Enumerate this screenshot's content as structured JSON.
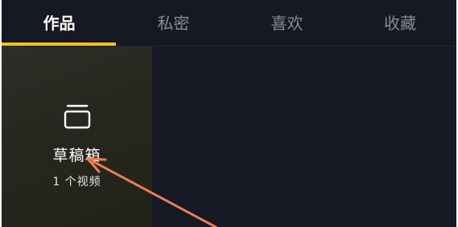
{
  "tabs": [
    {
      "label": "作品",
      "active": true
    },
    {
      "label": "私密",
      "active": false
    },
    {
      "label": "喜欢",
      "active": false
    },
    {
      "label": "收藏",
      "active": false
    }
  ],
  "draft": {
    "title": "草稿箱",
    "count": "1 个视频",
    "icon": "drafts-box-icon"
  },
  "colors": {
    "background": "#161824",
    "active_indicator": "#f3c21c",
    "annotation_arrow": "#ee7d56"
  }
}
